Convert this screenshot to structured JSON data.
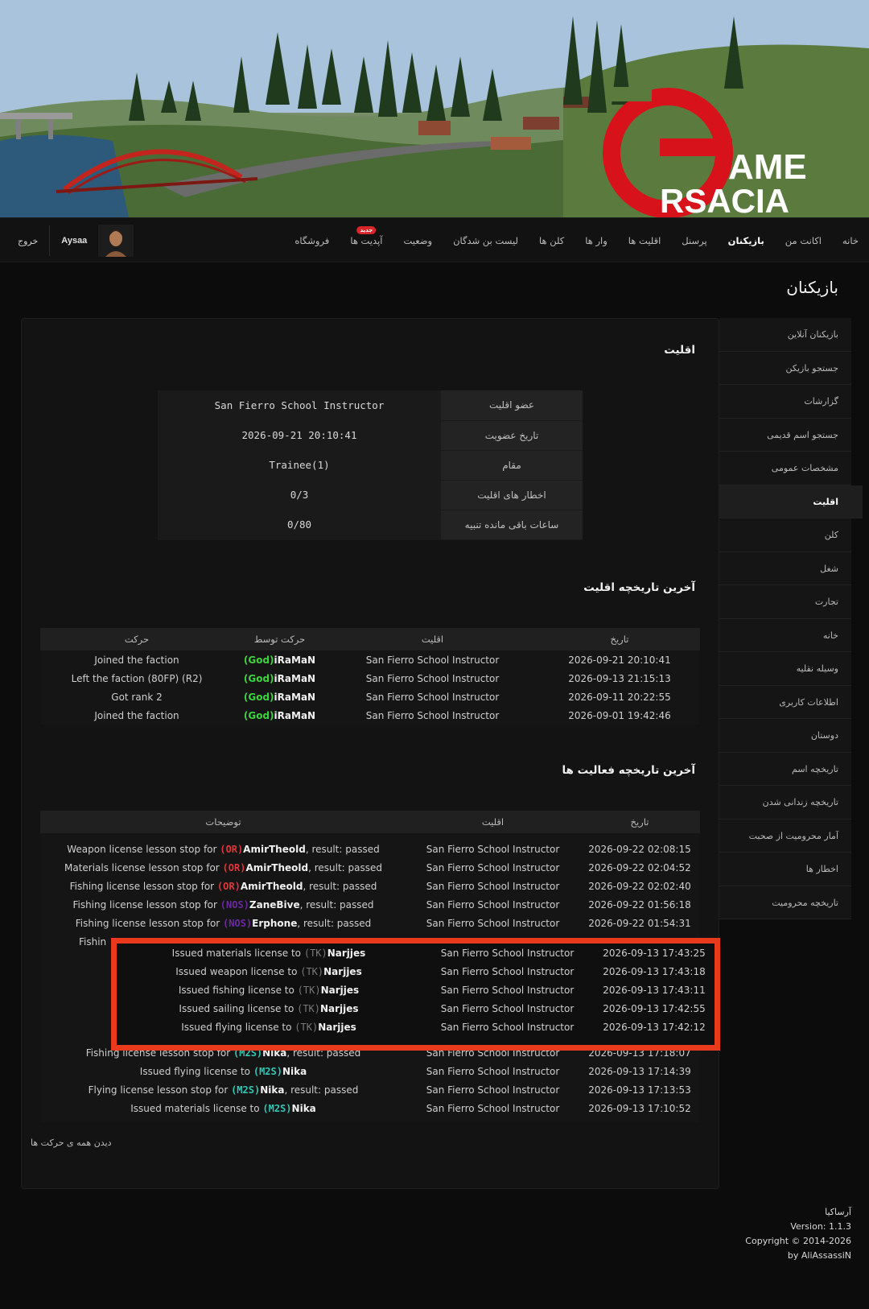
{
  "banner": {
    "logo_line1": "AME",
    "logo_line2": "RSACIA"
  },
  "nav": {
    "items": [
      "خانه",
      "اکانت من",
      "بازیکنان",
      "پرسنل",
      "اقلیت ها",
      "وار ها",
      "کلن ها",
      "لیست بن شدگان",
      "وضعیت",
      "آپدیت ها",
      "فروشگاه"
    ],
    "active": "بازیکنان",
    "new_badge": "جدید",
    "username": "Aysaa",
    "logout": "خروج"
  },
  "page_title": "بازیکنان",
  "sidebar": {
    "items": [
      "بازیکنان آنلاین",
      "جستجو بازیکن",
      "گزارشات",
      "جستجو اسم قدیمی",
      "مشخصات عمومی",
      "اقلیت",
      "کلن",
      "شغل",
      "تجارت",
      "خانه",
      "وسیله نقلیه",
      "اطلاعات کاربری",
      "دوستان",
      "تاریخچه اسم",
      "تاریخچه زندانی شدن",
      "آمار محرومیت از صحبت",
      "اخطار ها",
      "تاریخچه محرومیت"
    ],
    "active": "اقلیت"
  },
  "faction": {
    "title": "اقلیت",
    "rows": [
      {
        "label": "عضو اقلیت",
        "value": "San Fierro School Instructor"
      },
      {
        "label": "تاریخ عضویت",
        "value": "2026-09-21 20:10:41"
      },
      {
        "label": "مقام",
        "value": "Trainee(1)"
      },
      {
        "label": "اخطار های اقلیت",
        "value": "0/3"
      },
      {
        "label": "ساعات باقی مانده تنبیه",
        "value": "0/80"
      }
    ]
  },
  "faction_history": {
    "title": "آخرین تاریخچه اقلیت",
    "headers": {
      "date": "تاریخ",
      "faction": "اقلیت",
      "by": "حرکت توسط",
      "action": "حرکت"
    },
    "rows": [
      {
        "date": "2026-09-21 20:10:41",
        "faction": "San Fierro School Instructor",
        "by_tag": "(God)",
        "by_name": "iRaMaN",
        "action": "Joined the faction"
      },
      {
        "date": "2026-09-13 21:15:13",
        "faction": "San Fierro School Instructor",
        "by_tag": "(God)",
        "by_name": "iRaMaN",
        "action": "Left the faction (80FP) (R2)"
      },
      {
        "date": "2026-09-11 20:22:55",
        "faction": "San Fierro School Instructor",
        "by_tag": "(God)",
        "by_name": "iRaMaN",
        "action": "Got rank 2"
      },
      {
        "date": "2026-09-01 19:42:46",
        "faction": "San Fierro School Instructor",
        "by_tag": "(God)",
        "by_name": "iRaMaN",
        "action": "Joined the faction"
      }
    ]
  },
  "activity": {
    "title": "آخرین تاریخچه فعالیت ها",
    "headers": {
      "date": "تاریخ",
      "faction": "اقلیت",
      "desc": "توضیحات"
    },
    "rows_top": [
      {
        "date": "2026-09-22 02:08:15",
        "faction": "San Fierro School Instructor",
        "pre": "Weapon license lesson stop for ",
        "tag": "(OR)",
        "tag_class": "or",
        "name": "AmirTheold",
        "post": ", result: passed"
      },
      {
        "date": "2026-09-22 02:04:52",
        "faction": "San Fierro School Instructor",
        "pre": "Materials license lesson stop for ",
        "tag": "(OR)",
        "tag_class": "or",
        "name": "AmirTheold",
        "post": ", result: passed"
      },
      {
        "date": "2026-09-22 02:02:40",
        "faction": "San Fierro School Instructor",
        "pre": "Fishing license lesson stop for ",
        "tag": "(OR)",
        "tag_class": "or",
        "name": "AmirTheold",
        "post": ", result: passed"
      },
      {
        "date": "2026-09-22 01:56:18",
        "faction": "San Fierro School Instructor",
        "pre": "Fishing license lesson stop for ",
        "tag": "(NOS)",
        "tag_class": "nos",
        "name": "ZaneBive",
        "post": ", result: passed"
      },
      {
        "date": "2026-09-22 01:54:31",
        "faction": "San Fierro School Instructor",
        "pre": "Fishing license lesson stop for ",
        "tag": "(NOS)",
        "tag_class": "nos",
        "name": "Erphone",
        "post": ", result: passed"
      }
    ],
    "partial_row_text": "Fishin",
    "rows_highlight": [
      {
        "date": "2026-09-13 17:43:25",
        "faction": "San Fierro School Instructor",
        "pre": "Issued materials license to ",
        "tag": "(TK)",
        "tag_class": "tk",
        "name": "Narjjes",
        "post": ""
      },
      {
        "date": "2026-09-13 17:43:18",
        "faction": "San Fierro School Instructor",
        "pre": "Issued weapon license to ",
        "tag": "(TK)",
        "tag_class": "tk",
        "name": "Narjjes",
        "post": ""
      },
      {
        "date": "2026-09-13 17:43:11",
        "faction": "San Fierro School Instructor",
        "pre": "Issued fishing license to ",
        "tag": "(TK)",
        "tag_class": "tk",
        "name": "Narjjes",
        "post": ""
      },
      {
        "date": "2026-09-13 17:42:55",
        "faction": "San Fierro School Instructor",
        "pre": "Issued sailing license to ",
        "tag": "(TK)",
        "tag_class": "tk",
        "name": "Narjjes",
        "post": ""
      },
      {
        "date": "2026-09-13 17:42:12",
        "faction": "San Fierro School Instructor",
        "pre": "Issued flying license to ",
        "tag": "(TK)",
        "tag_class": "tk",
        "name": "Narjjes",
        "post": ""
      }
    ],
    "rows_bottom": [
      {
        "date": "2026-09-13 17:18:07",
        "faction": "San Fierro School Instructor",
        "pre": "Fishing license lesson stop for ",
        "tag": "(M2S)",
        "tag_class": "m2s",
        "name": "Nika",
        "post": ", result: passed"
      },
      {
        "date": "2026-09-13 17:14:39",
        "faction": "San Fierro School Instructor",
        "pre": "Issued flying license to ",
        "tag": "(M2S)",
        "tag_class": "m2s",
        "name": "Nika",
        "post": ""
      },
      {
        "date": "2026-09-13 17:13:53",
        "faction": "San Fierro School Instructor",
        "pre": "Flying license lesson stop for ",
        "tag": "(M2S)",
        "tag_class": "m2s",
        "name": "Nika",
        "post": ", result: passed"
      },
      {
        "date": "2026-09-13 17:10:52",
        "faction": "San Fierro School Instructor",
        "pre": "Issued materials license to ",
        "tag": "(M2S)",
        "tag_class": "m2s",
        "name": "Nika",
        "post": ""
      }
    ],
    "see_all": "دیدن همه ی حرکت ها"
  },
  "footer": {
    "site": "آرساکیا",
    "version": "Version: 1.1.3",
    "copyright": "Copyright © 2014-2026",
    "author": "by AliAssassiN"
  },
  "colors": {
    "highlight_border": "#ea3a1e",
    "link": "#3a8fe0",
    "god": "#3bd43b",
    "or": "#e0353b",
    "nos": "#6b2a9e",
    "m2s": "#2fc7b7"
  }
}
